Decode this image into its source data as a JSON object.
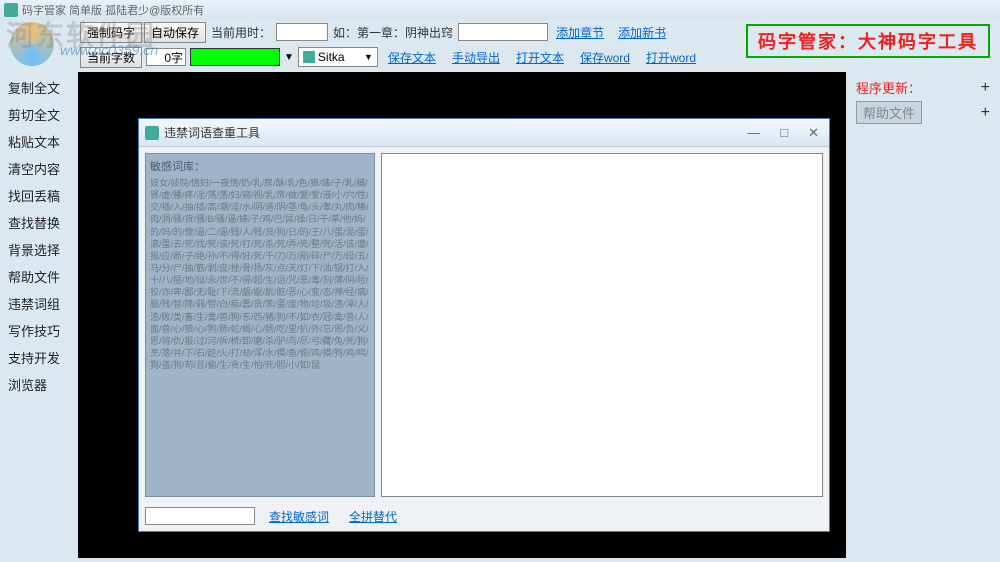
{
  "title": "码字管家 简单版  孤陆君少@版权所有",
  "topbar1": {
    "force_type": "强制码字",
    "autosave": "自动保存",
    "time_label": "当前用时：",
    "time_val": "",
    "example": "如：第一章：阴神出窍",
    "add_chapter": "添加章节",
    "add_book": "添加新书"
  },
  "topbar2": {
    "count_label": "当前字数",
    "count_val": "0字",
    "font": "Sitka",
    "save_text": "保存文本",
    "manual_export": "手动导出",
    "open_text": "打开文本",
    "save_word": "保存word",
    "open_word": "打开word"
  },
  "banner": "码字管家：大神码字工具",
  "sidebar": [
    "复制全文",
    "剪切全文",
    "粘贴文本",
    "清空内容",
    "找回丢稿",
    "查找替换",
    "背景选择",
    "帮助文件",
    "违禁词组",
    "写作技巧",
    "支持开发",
    "浏览器"
  ],
  "right": {
    "update": "程序更新：",
    "help": "帮助文件"
  },
  "dialog": {
    "title": "违禁词语查重工具",
    "lib_head": "敏感词库：",
    "lib_body": "妓女/妓院/情妇/一夜情/奶/乳/房/酥/乳/色/狼/婊/子/乳/脯/肾/虚/腰/疼/淫/荡/荡/妇/窥/视/乳/房/做/爱/爱/液/小/穴/性/交/插/入/抽/插/高/潮/淫/水/阴/道/阴/茎/龟/头/睾/丸/肉/棒/肉/洞/骚/货/骚/B/骚/逼/婊/子/鸡/巴/屌/操/日/干/草/他/妈/的/妈/的/傻/逼/二/逼/贱/人/贱/货/狗/日/的/王/八/蛋/混/蛋/滚/蛋/去/死/找/死/该/死/打/死/杀/死/弄/死/整/死/活/该/遭/报/应/断/子/绝/孙/不/得/好/死/千/刀/万/剐/碎/尸/万/段/五/马/分/尸/抽/筋/剥/皮/挫/骨/扬/灰/点/天/灯/下/油/锅/打/入/十/八/层/地/狱/永/世/不/得/超/生/诅/咒/恶/毒/刻/薄/阴/险/狡/诈/卑/鄙/无/耻/下/流/龌/龊/肮/脏/恶/心/变/态/神/经/病/脑/残/智/障/弱/智/白/痴/蠢/货/笨/蛋/废/物/垃/圾/渣/滓/人/渣/败/类/畜/生/禽/兽/狗/东/西/猪/狗/不/如/衣/冠/禽/兽/人/面/兽/心/狼/心/狗/肺/蛇/蝎/心/肠/吃/里/扒/外/忘/恩/负/义/恩/将/仇/报/过/河/拆/桥/卸/磨/杀/驴/鸟/尽/弓/藏/兔/死/狗/烹/落/井/下/石/趁/火/打/劫/浑/水/摸/鱼/偷/鸡/摸/狗/鸡/鸣/狗/盗/狗/苟/且/偷/生/贪/生/怕/死/胆/小/如/鼠",
    "search_btn": "查找敏感词",
    "replace_btn": "全拼替代"
  },
  "watermark": "www.pc0359.cn",
  "wm_brand": "河东软件园"
}
